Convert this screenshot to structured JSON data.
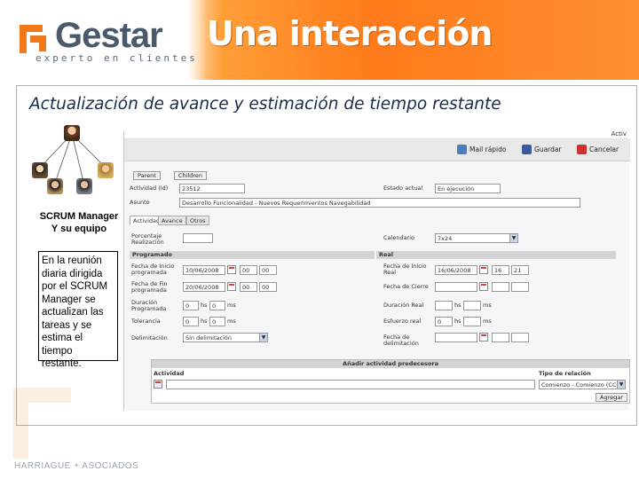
{
  "header": {
    "logo_name": "Gestar",
    "logo_tagline": "experto en clientes",
    "title": "Una interacción"
  },
  "slide": {
    "title": "Actualización de avance y estimación de tiempo restante",
    "caption_line1": "SCRUM Manager",
    "caption_line2": "Y su equipo",
    "note": "En la reunión diaria dirigida por el SCRUM Manager se actualizan las tareas y se estima el tiempo restante."
  },
  "app": {
    "topbar_link": "Activ",
    "toolbar": {
      "mail_label": "Mail rápido",
      "save_label": "Guardar",
      "cancel_label": "Cancelar"
    },
    "buttons": {
      "parent": "Parent",
      "children": "Children"
    },
    "fields": {
      "activity_label": "Actividad (Id)",
      "activity_value": "23512",
      "status_label": "Estado actual",
      "status_value": "En ejecución",
      "subject_label": "Asunto",
      "subject_value": "Desarrollo Funcionalidad - Nuevos Requerimientos Navegabilidad"
    },
    "tabs": [
      "Actividad",
      "Avance",
      "Otros"
    ],
    "progress": {
      "percent_label": "Porcentaje Realización",
      "percent_value": "",
      "calendar_label": "Calendario",
      "calendar_value": "7x24"
    },
    "programmed": {
      "header": "Programado",
      "start_label": "Fecha de Inicio programada",
      "start_date": "10/06/2008",
      "start_hour": "00",
      "start_min": "00",
      "end_label": "Fecha de Fin programada",
      "end_date": "20/06/2008",
      "end_hour": "00",
      "end_min": "00",
      "duration_label": "Duración Programada",
      "duration_hours": "0",
      "duration_ms": "0",
      "tolerance_label": "Tolerancia",
      "tolerance_hours": "0",
      "tolerance_ms": "0",
      "delimitation_label": "Delimitación",
      "delimitation_value": "Sin delimitación",
      "hs_unit": "hs",
      "ms_unit": "ms"
    },
    "real": {
      "header": "Real",
      "start_label": "Fecha de Inicio Real",
      "start_date": "16/06/2008",
      "start_hour": "16",
      "start_min": "21",
      "close_label": "Fecha de Cierre",
      "duration_label": "Duración Real",
      "duration_hours": "",
      "duration_ms": "",
      "effort_label": "Esfuerzo real",
      "effort_hours": "0",
      "effort_ms": "",
      "delim_date_label": "Fecha de delimitación",
      "hs_unit": "hs",
      "ms_unit": "ms"
    },
    "predecessor": {
      "header": "Añadir actividad predecesora",
      "col_activity": "Actividad",
      "col_type": "Tipo de relación",
      "type_value": "Comienzo - Comienzo (CC)",
      "add_button": "Agregar"
    }
  },
  "footer": "HARRIAGUE + ASOCIADOS"
}
